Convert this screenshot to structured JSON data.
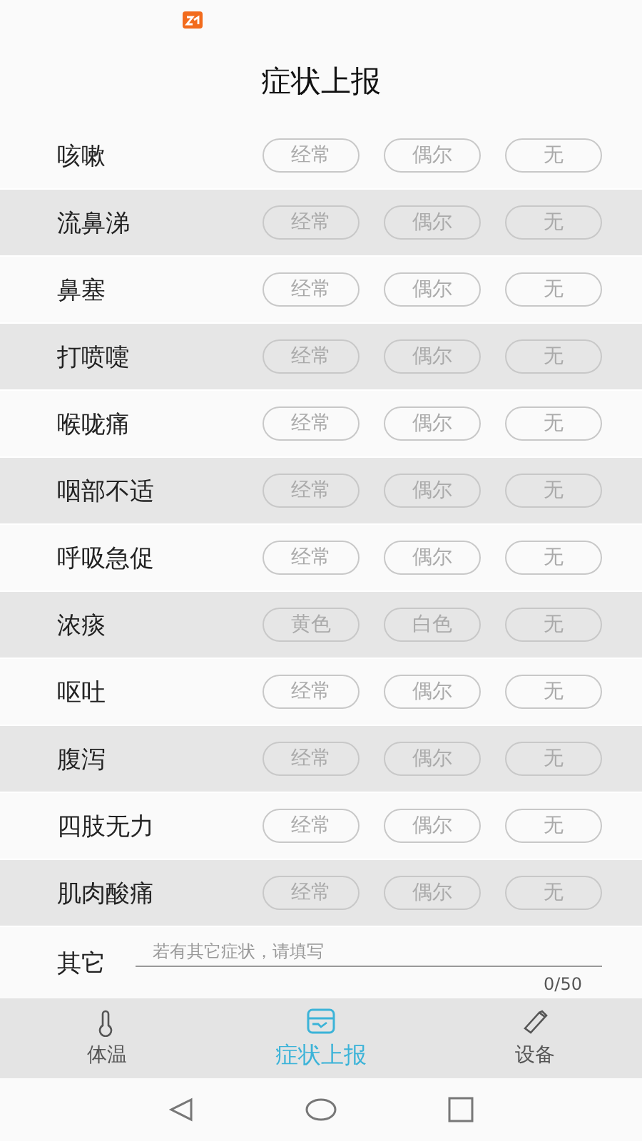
{
  "title": "症状上报",
  "symptoms": [
    {
      "name": "咳嗽",
      "options": [
        {
          "label": "经常",
          "selected": false
        },
        {
          "label": "偶尔",
          "selected": false
        },
        {
          "label": "无",
          "selected": false
        }
      ]
    },
    {
      "name": "流鼻涕",
      "options": [
        {
          "label": "经常",
          "selected": false
        },
        {
          "label": "偶尔",
          "selected": false
        },
        {
          "label": "无",
          "selected": false
        }
      ]
    },
    {
      "name": "鼻塞",
      "options": [
        {
          "label": "经常",
          "selected": false
        },
        {
          "label": "偶尔",
          "selected": false
        },
        {
          "label": "无",
          "selected": false
        }
      ]
    },
    {
      "name": "打喷嚏",
      "options": [
        {
          "label": "经常",
          "selected": false
        },
        {
          "label": "偶尔",
          "selected": false
        },
        {
          "label": "无",
          "selected": false
        }
      ]
    },
    {
      "name": "喉咙痛",
      "options": [
        {
          "label": "经常",
          "selected": false
        },
        {
          "label": "偶尔",
          "selected": false
        },
        {
          "label": "无",
          "selected": false
        }
      ]
    },
    {
      "name": "咽部不适",
      "options": [
        {
          "label": "经常",
          "selected": false
        },
        {
          "label": "偶尔",
          "selected": false
        },
        {
          "label": "无",
          "selected": false
        }
      ]
    },
    {
      "name": "呼吸急促",
      "options": [
        {
          "label": "经常",
          "selected": false
        },
        {
          "label": "偶尔",
          "selected": false
        },
        {
          "label": "无",
          "selected": false
        }
      ]
    },
    {
      "name": "浓痰",
      "options": [
        {
          "label": "黄色",
          "selected": false
        },
        {
          "label": "白色",
          "selected": false
        },
        {
          "label": "无",
          "selected": false
        }
      ]
    },
    {
      "name": "呕吐",
      "options": [
        {
          "label": "经常",
          "selected": false
        },
        {
          "label": "偶尔",
          "selected": false
        },
        {
          "label": "无",
          "selected": false
        }
      ]
    },
    {
      "name": "腹泻",
      "options": [
        {
          "label": "经常",
          "selected": false
        },
        {
          "label": "偶尔",
          "selected": false
        },
        {
          "label": "无",
          "selected": false
        }
      ]
    },
    {
      "name": "四肢无力",
      "options": [
        {
          "label": "经常",
          "selected": false
        },
        {
          "label": "偶尔",
          "selected": false
        },
        {
          "label": "无",
          "selected": false
        }
      ]
    },
    {
      "name": "肌肉酸痛",
      "options": [
        {
          "label": "经常",
          "selected": false
        },
        {
          "label": "偶尔",
          "selected": false
        },
        {
          "label": "无",
          "selected": false
        }
      ]
    }
  ],
  "other": {
    "label": "其它",
    "placeholder": "若有其它症状，请填写",
    "counter": "0/50"
  },
  "tabs": [
    {
      "kind": "thermometer",
      "label": "体温",
      "selected": false
    },
    {
      "kind": "report",
      "label": "症状上报",
      "selected": true
    },
    {
      "kind": "device",
      "label": "设备",
      "selected": false
    }
  ]
}
